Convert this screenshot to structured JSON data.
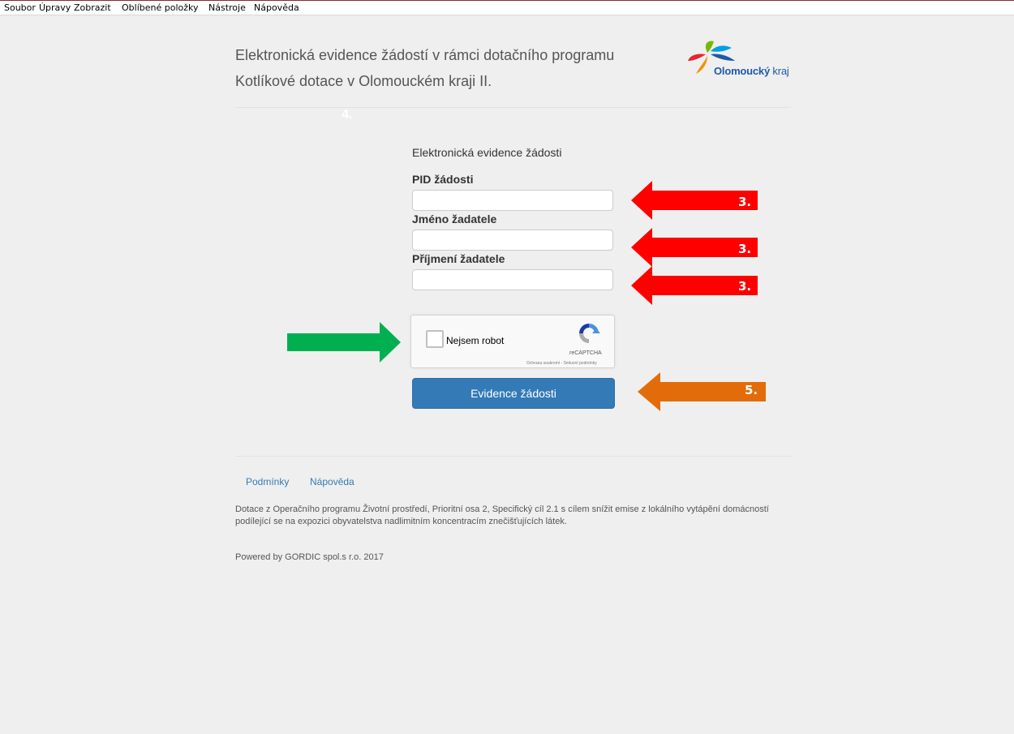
{
  "menu": [
    "Soubor",
    "Úpravy",
    "Zobrazit",
    "Oblíbené položky",
    "Nástroje",
    "Nápověda"
  ],
  "header": {
    "title_line1": "Elektronická evidence žádostí v rámci dotačního programu",
    "title_line2": "Kotlíkové dotace v Olomouckém kraji II.",
    "logo_text_bold": "Olomoucký",
    "logo_text_light": "kraj"
  },
  "annotations": {
    "step4": "4.",
    "pid_step": "3.",
    "first_name_step": "3.",
    "last_name_step": "3.",
    "submit_step": "5."
  },
  "form": {
    "heading": "Elektronická evidence žádosti",
    "pid_label": "PID žádosti",
    "pid_value": "",
    "first_name_label": "Jméno žadatele",
    "first_name_value": "",
    "last_name_label": "Příjmení žadatele",
    "last_name_value": "",
    "captcha_label": "Nejsem robot",
    "captcha_brand": "reCAPTCHA",
    "captcha_terms": "Ochrana soukromí - Smluvní podmínky",
    "submit_label": "Evidence žádosti"
  },
  "footer": {
    "links": [
      "Podmínky",
      "Nápověda"
    ],
    "description": "Dotace z Operačního programu Životní prostředí, Prioritní osa 2, Specifický cíl 2.1 s cílem snížit emise z lokálního vytápění domácností podílející se na expozici obyvatelstva nadlimitním koncentracím znečišťujících látek.",
    "powered": "Powered by GORDIC spol.s r.o. 2017"
  },
  "colors": {
    "arrow_red": "#ff0000",
    "arrow_green": "#00b050",
    "arrow_orange": "#e36c0a",
    "button": "#337ab7",
    "link": "#337ab7"
  }
}
